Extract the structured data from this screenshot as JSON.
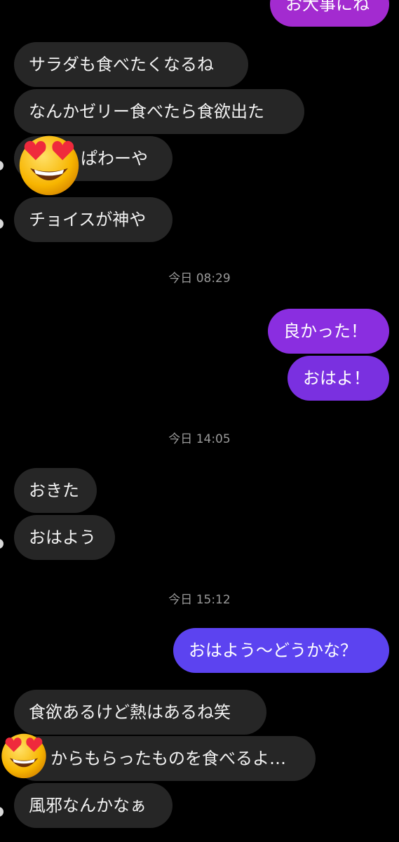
{
  "messages": {
    "m0": "お大事にね",
    "m1": "サラダも食べたくなるね",
    "m2": "なんかゼリー食べたら食欲出た",
    "m3": "ぱわーや",
    "m4": "チョイスが神や",
    "m5": "良かった！",
    "m6": "おはよ！",
    "m7": "おきた",
    "m8": "おはよう",
    "m9": "おはよう〜どうかな？",
    "m10": "食欲あるけど熱はあるね笑",
    "m11": "からもらったものを食べるよ…",
    "m12": "風邪なんかなぁ"
  },
  "timestamps": {
    "t1": "今日 08:29",
    "t2": "今日 14:05",
    "t3": "今日 15:12"
  },
  "reactions": {
    "r1": "heart-eyes",
    "r2": "heart-eyes"
  },
  "colors": {
    "incoming_bubble": "#262626",
    "outgoing_top": "#9c2bd6",
    "outgoing_mid": "#7a30e0",
    "outgoing_bottom": "#5c43f0",
    "background": "#000000",
    "timestamp": "#9a9a9a"
  }
}
